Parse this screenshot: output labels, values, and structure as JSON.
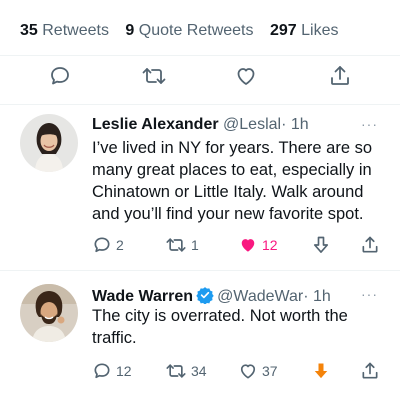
{
  "stats": {
    "retweets_count": "35",
    "retweets_label": "Retweets",
    "quotes_count": "9",
    "quotes_label": "Quote Retweets",
    "likes_count": "297",
    "likes_label": "Likes"
  },
  "actions": {
    "icons": [
      "reply-icon",
      "retweet-icon",
      "like-icon",
      "share-icon"
    ]
  },
  "tweets": [
    {
      "name": "Leslie Alexander",
      "handle": "@Leslal",
      "time": "· 1h",
      "text": "I’ve lived in NY for years. There are so many great places to eat, especially in Chinatown or Little Italy. Walk around and you’ll find your new favorite spot.",
      "replies": "2",
      "retweets": "1",
      "likes": "12",
      "liked": true
    },
    {
      "name": "Wade Warren",
      "handle": "@WadeWar",
      "time": "· 1h",
      "text": "The city is overrated. Not worth the traffic.",
      "replies": "12",
      "retweets": "34",
      "likes": "37",
      "verified": true,
      "downvoted": true
    }
  ],
  "colors": {
    "like_active": "#f91880",
    "downvote_active": "#f4830a",
    "verified": "#1d9bf0",
    "secondary_text": "#536471"
  }
}
